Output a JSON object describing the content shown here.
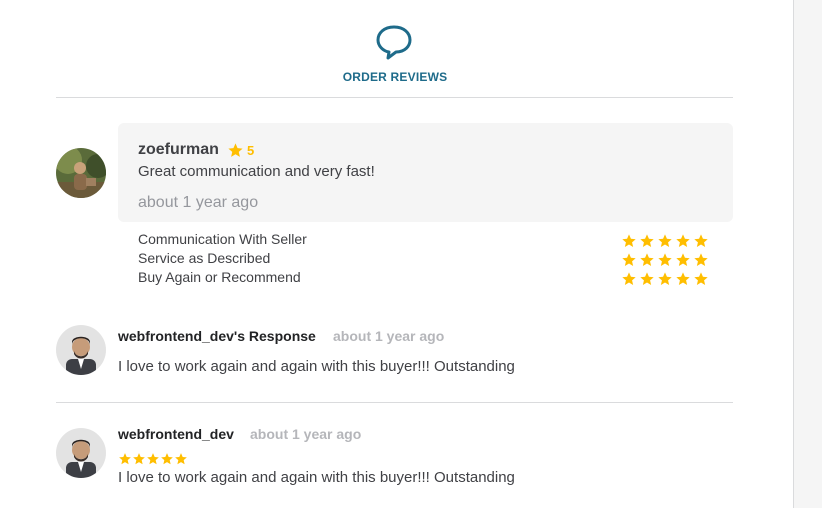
{
  "header": {
    "title": "ORDER REVIEWS",
    "icon": "chat-bubble-icon"
  },
  "review": {
    "username": "zoefurman",
    "rating": "5",
    "text": "Great communication and very fast!",
    "time": "about 1 year ago",
    "categories": [
      {
        "label": "Communication With Seller",
        "stars": 5
      },
      {
        "label": "Service as Described",
        "stars": 5
      },
      {
        "label": "Buy Again or Recommend",
        "stars": 5
      }
    ]
  },
  "seller_response": {
    "name": "webfrontend_dev's Response",
    "time": "about 1 year ago",
    "text": "I love to work again and again with this buyer!!! Outstanding"
  },
  "seller_review": {
    "name": "webfrontend_dev",
    "time": "about 1 year ago",
    "stars": 5,
    "text": "I love to work again and again with this buyer!!! Outstanding"
  },
  "colors": {
    "accent": "#1e6b8a",
    "star": "#ffbe00",
    "box": "#f5f5f5"
  }
}
